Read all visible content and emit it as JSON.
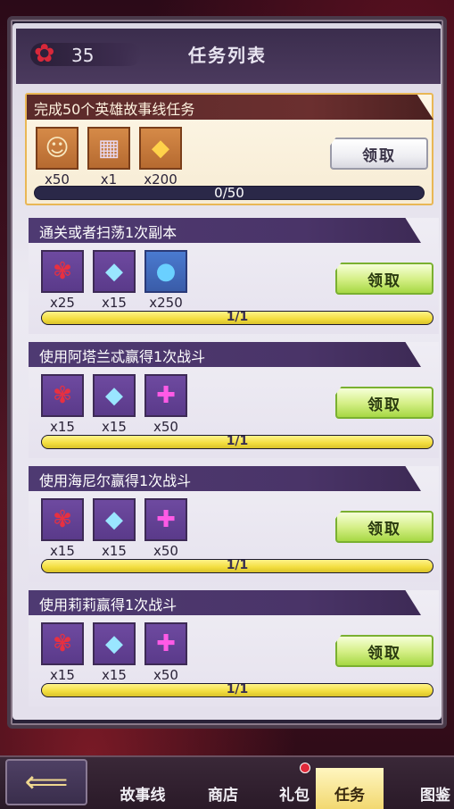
{
  "header": {
    "currency_icon": "red-spider-lily-icon",
    "currency_count": "35",
    "title": "任务列表"
  },
  "featured_task": {
    "title": "完成50个英雄故事线任务",
    "rewards": [
      {
        "icon": "hero-portrait-icon",
        "qty": "x50"
      },
      {
        "icon": "book-icon",
        "qty": "x1"
      },
      {
        "icon": "gold-crystal-icon",
        "qty": "x200"
      }
    ],
    "progress_text": "0/50",
    "progress": 0,
    "button_label": "领取"
  },
  "tasks": [
    {
      "title": "通关或者扫荡1次副本",
      "rewards": [
        {
          "icon": "red-flower-icon",
          "qty": "x25"
        },
        {
          "icon": "blue-crystal-icon",
          "qty": "x15"
        },
        {
          "icon": "blue-potion-icon",
          "qty": "x250"
        }
      ],
      "progress_text": "1/1",
      "progress": 1,
      "button_label": "领取"
    },
    {
      "title": "使用阿塔兰忒赢得1次战斗",
      "rewards": [
        {
          "icon": "red-flower-icon",
          "qty": "x15"
        },
        {
          "icon": "blue-crystal-icon",
          "qty": "x15"
        },
        {
          "icon": "puzzle-piece-icon",
          "qty": "x50"
        }
      ],
      "progress_text": "1/1",
      "progress": 1,
      "button_label": "领取"
    },
    {
      "title": "使用海尼尔赢得1次战斗",
      "rewards": [
        {
          "icon": "red-flower-icon",
          "qty": "x15"
        },
        {
          "icon": "blue-crystal-icon",
          "qty": "x15"
        },
        {
          "icon": "puzzle-piece-icon",
          "qty": "x50"
        }
      ],
      "progress_text": "1/1",
      "progress": 1,
      "button_label": "领取"
    },
    {
      "title": "使用莉莉赢得1次战斗",
      "rewards": [
        {
          "icon": "red-flower-icon",
          "qty": "x15"
        },
        {
          "icon": "blue-crystal-icon",
          "qty": "x15"
        },
        {
          "icon": "puzzle-piece-icon",
          "qty": "x50"
        }
      ],
      "progress_text": "1/1",
      "progress": 1,
      "button_label": "领取"
    }
  ],
  "bottom_nav": {
    "back_icon": "back-arrow-icon",
    "tabs": [
      "故事线",
      "商店",
      "礼包",
      "任务",
      "图鉴"
    ],
    "active": "任务"
  },
  "colors": {
    "accent_green": "#a6d844",
    "progress_yellow": "#f2dd3e",
    "card_header_purple": "#4e3a72",
    "featured_header_red": "#6b2f2f",
    "featured_border_gold": "#e9b755"
  }
}
